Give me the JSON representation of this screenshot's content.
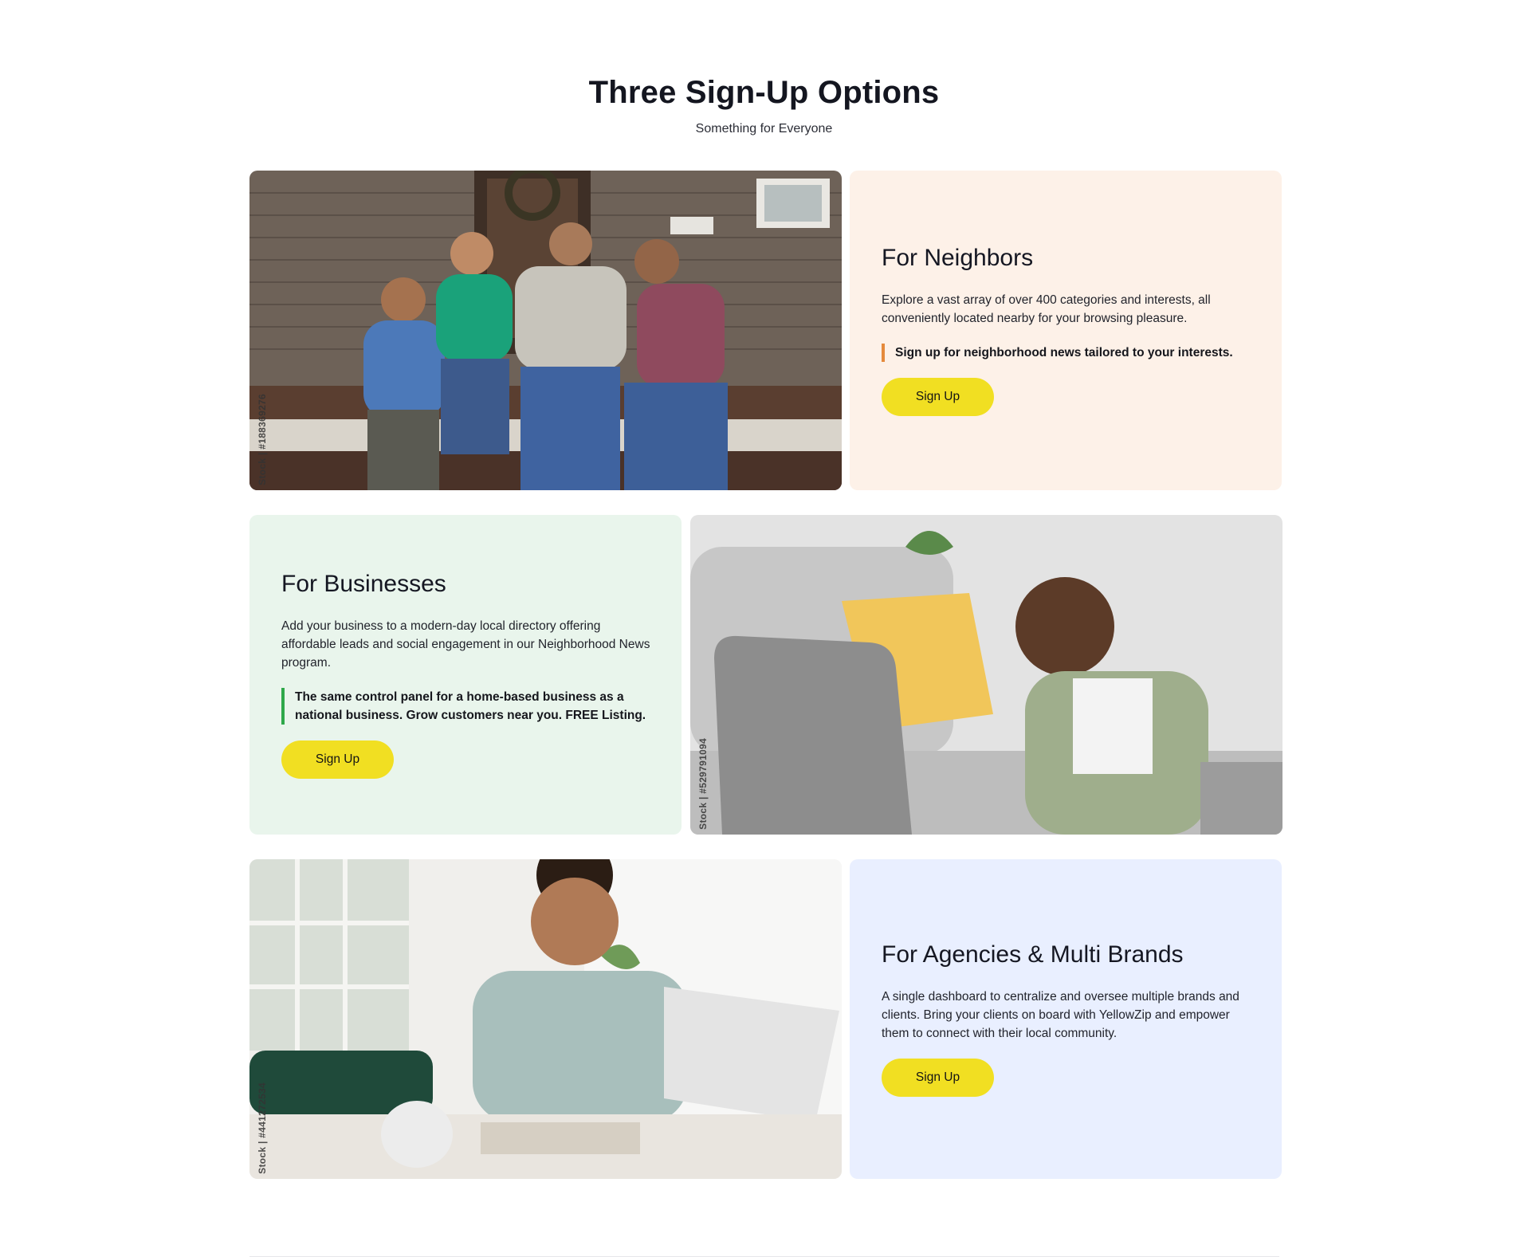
{
  "header": {
    "title": "Three Sign-Up Options",
    "subtitle": "Something for Everyone"
  },
  "options": [
    {
      "title": "For Neighbors",
      "description": "Explore a vast array of over 400 categories and interests, all conveniently located nearby for your browsing pleasure.",
      "highlight": "Sign up for neighborhood news tailored to your interests.",
      "button_label": "Sign Up",
      "photo_id": "Stock | #188369276",
      "card_color": "#fdf1e8",
      "accent_color": "#e58a3c"
    },
    {
      "title": "For Businesses",
      "description": "Add your business to a modern-day local directory offering affordable leads and social engagement in our Neighborhood News program.",
      "highlight": "The same control panel for a home-based business as a national business. Grow customers near you. FREE Listing.",
      "button_label": "Sign Up",
      "photo_id": "Stock | #529791094",
      "card_color": "#e9f5ec",
      "accent_color": "#2ea84a"
    },
    {
      "title": "For Agencies & Multi Brands",
      "description": "A single dashboard to centralize and oversee multiple brands and clients. Bring your clients on board with YellowZip and empower them to connect with their local community.",
      "button_label": "Sign Up",
      "photo_id": "Stock | #441272534",
      "card_color": "#e9efff"
    }
  ],
  "colors": {
    "button": "#f1df22",
    "page_background": "#ffffff"
  }
}
